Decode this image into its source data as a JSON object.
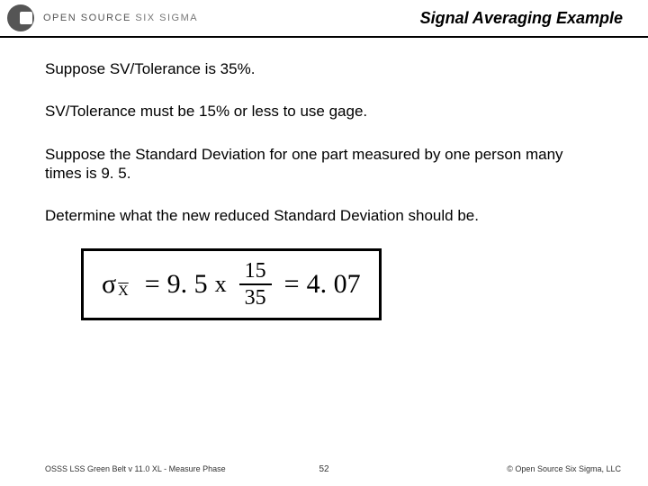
{
  "header": {
    "brand_strong": "OPEN SOURCE",
    "brand_light": "SIX SIGMA",
    "title": "Signal Averaging Example"
  },
  "body": {
    "p1": "Suppose SV/Tolerance is 35%.",
    "p2": "SV/Tolerance must be 15% or less to use gage.",
    "p3": "Suppose the Standard Deviation for one part measured by one person many times is 9. 5.",
    "p4": "Determine what the new reduced Standard Deviation should be."
  },
  "formula": {
    "sigma": "σ",
    "sub": "X",
    "eq": "=",
    "val1": "9. 5",
    "mul": "x",
    "num": "15",
    "den": "35",
    "result": "4. 07"
  },
  "footer": {
    "left": "OSSS LSS Green Belt v 11.0 XL - Measure Phase",
    "center": "52",
    "right": "© Open Source Six Sigma, LLC"
  }
}
